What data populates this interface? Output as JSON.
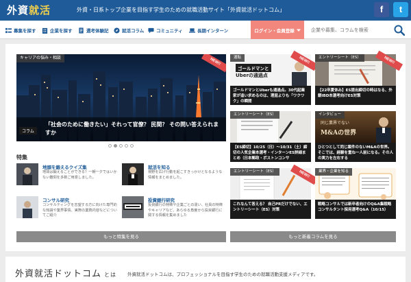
{
  "header": {
    "logo_main": "外資",
    "logo_accent": "就活",
    "tagline": "外資・日系トップ企業を目指す学生のための就職活動サイト「外資就活ドットコム」",
    "sns": {
      "facebook": "f",
      "twitter": "t"
    }
  },
  "nav": {
    "items": [
      {
        "label": "募集を探す",
        "icon": "search-list-icon"
      },
      {
        "label": "企業を探す",
        "icon": "building-icon"
      },
      {
        "label": "選考体験記",
        "icon": "document-icon"
      },
      {
        "label": "就活コラム",
        "icon": "compass-icon"
      },
      {
        "label": "コミュニティ",
        "icon": "chat-icon"
      },
      {
        "label": "長期インターン",
        "icon": "laptop-icon"
      }
    ],
    "login_label": "ログイン・会員登録",
    "search_placeholder": "企業や募集、コラムを検索"
  },
  "hero": {
    "category": "キャリアの悩み・相談",
    "badge": "NEW!!",
    "tag": "コラム",
    "title": "「社会のために働きたい」それって官僚？ 民間？ その問い答えられますか"
  },
  "carousel": {
    "count": 5,
    "active": 1
  },
  "features": {
    "heading": "特集",
    "items": [
      {
        "title": "地頭を鍛えるクイズ集",
        "desc": "地頭は鍛えることができる？一朝一夕ではいかない難問を多数ご用意しました。"
      },
      {
        "title": "就活を知る",
        "desc": "視野を広げ行動を起こすきっかけとなるような情報をまとめました。"
      },
      {
        "title": "コンサル研究",
        "desc": "コンサルティングを志望する方に向けた専門的な知識や業界事情、実際の業務内容などについてご紹介"
      },
      {
        "title": "投資銀行研究",
        "desc": "投資銀行の特徴や企業ごとの違い、社員の特徴やキャリアなど、あらゆる角度から投資銀行に関する情報を集めました"
      }
    ],
    "more_label": "もっと特集を見る"
  },
  "cards": [
    {
      "category": "運転",
      "badge": "NEW!!",
      "img_text_1": "ゴールドマンと",
      "img_text_2": "Uber",
      "img_text_3": "の通過点",
      "caption": "ゴールドマンとUberも通過点。30代起業家が追い求めるのは、理屈よりも「ワクワク」の瞬間"
    },
    {
      "category": "エントリーシート（ES）",
      "badge": "NEW!!",
      "caption": "【22卒夏休み】ES提出締切の時はなる、外銀IBD本選考向けES対策"
    },
    {
      "category": "エントリーシート（ES）",
      "badge": "",
      "caption": "【ES締切】10/25（日）〜10/31（土）締切の人気企業本選考・インターンES詳細まとめ（日本郵政・ボストンコンサ"
    },
    {
      "category": "インタビュー",
      "badge": "",
      "img_text_1": "同じ業界でない",
      "img_text_2": "M&Aの世界",
      "caption": "ひとつとして同じ案件のないM&Aの世界。そこでは、経験を重ね一人前になる。その人の実力を左右する"
    },
    {
      "category": "エントリーシート（ES）",
      "badge": "NEW!!",
      "caption": "これなんて答える？ 自己PRだけでない、エントリーシート（ES）対策"
    },
    {
      "category": "業界・企業を知る",
      "badge": "",
      "caption": "戦略コンサルでは新卒者向けのQ&A集戦略コンサルタント採用選考Q&A（10/15）"
    }
  ],
  "cards_more_label": "もっと新着コラムを見る",
  "about": {
    "title": "外資就活ドットコム",
    "suffix": "とは",
    "text": "外資就活ドットコムは、プロフェッショナルを目指す学生のための就職活動支援メディアです。"
  },
  "colors": {
    "brand": "#1e5b98",
    "login": "#f2877d",
    "accent": "#f2d04b",
    "new_badge": "#e04b4b"
  }
}
